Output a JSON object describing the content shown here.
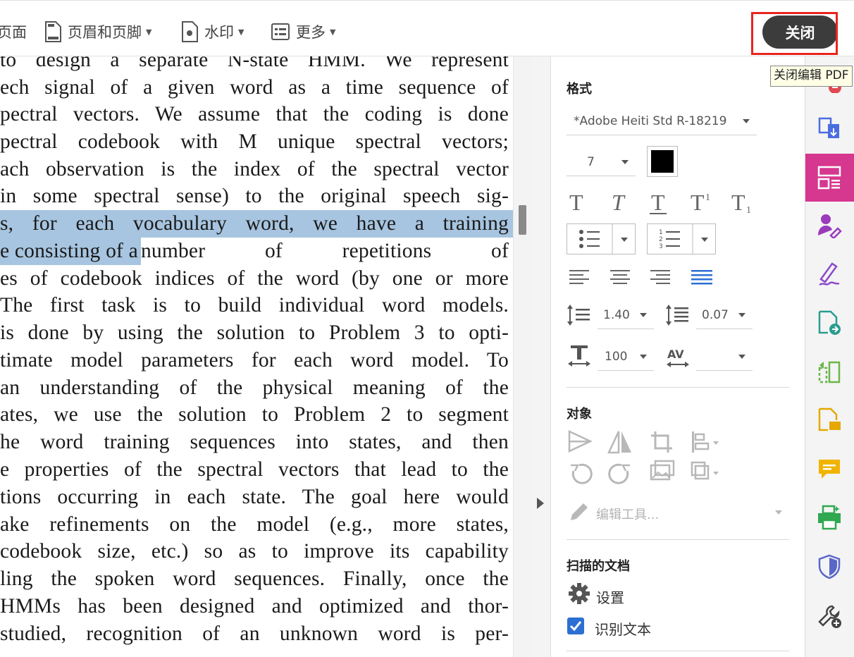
{
  "toolbar": {
    "items": [
      {
        "label": "页面"
      },
      {
        "label": "页眉和页脚"
      },
      {
        "label": "水印"
      },
      {
        "label": "更多"
      }
    ],
    "close_label": "关闭",
    "close_tooltip": "关闭编辑 PDF"
  },
  "document": {
    "lines": [
      {
        "text": "to design a separate N-state HMM. We represent"
      },
      {
        "text": "ech signal of a given word as a time sequence of"
      },
      {
        "text": "pectral vectors. We assume that the coding is done"
      },
      {
        "text": "pectral codebook with M unique spectral vectors;"
      },
      {
        "text": "ach observation is the index of the spectral vector"
      },
      {
        "text": "in some spectral sense) to the original speech sig-"
      },
      {
        "text": "s, for each vocabulary word, we have a training"
      },
      {
        "text_selected": "e consisting of a",
        "text_rest": " number of repetitions of"
      },
      {
        "text": "es of codebook indices of the word (by one or more"
      },
      {
        "text": "The first task is to build individual word models."
      },
      {
        "text": "is done by using the solution to Problem 3 to opti-"
      },
      {
        "text": "timate model parameters for each word model. To"
      },
      {
        "text": "an understanding of the physical meaning of the"
      },
      {
        "text": "ates, we use the solution to Problem 2 to segment"
      },
      {
        "text": "he word training sequences into states, and then"
      },
      {
        "text": "e properties of the spectral vectors that lead to the"
      },
      {
        "text": "tions occurring in each state. The goal here would"
      },
      {
        "text": "ake refinements on the model (e.g., more states,"
      },
      {
        "text": "codebook size, etc.) so as to improve its capability"
      },
      {
        "text": "ling the spoken word sequences. Finally, once the"
      },
      {
        "text": "HMMs has been designed and optimized and thor-"
      },
      {
        "text": "studied, recognition of an unknown word is per-"
      }
    ]
  },
  "panel": {
    "format_title": "格式",
    "font_name": "*Adobe Heiti Std R-18219",
    "font_size": "7",
    "font_color": "#000000",
    "line_spacing": "1.40",
    "para_spacing": "0.07",
    "horiz_scale": "100",
    "char_spacing": "",
    "objects_title": "对象",
    "edit_tool_label": "编辑工具...",
    "scanned_title": "扫描的文档",
    "settings_label": "设置",
    "recognize_label": "识别文本",
    "recognize_checked": true
  },
  "colors": {
    "accent_blue": "#2d6fd2",
    "close_button": "#3c3c3c",
    "highlight_red": "#e8241d",
    "rail_active": "#d6378f",
    "selection": "#a7c5e0"
  }
}
